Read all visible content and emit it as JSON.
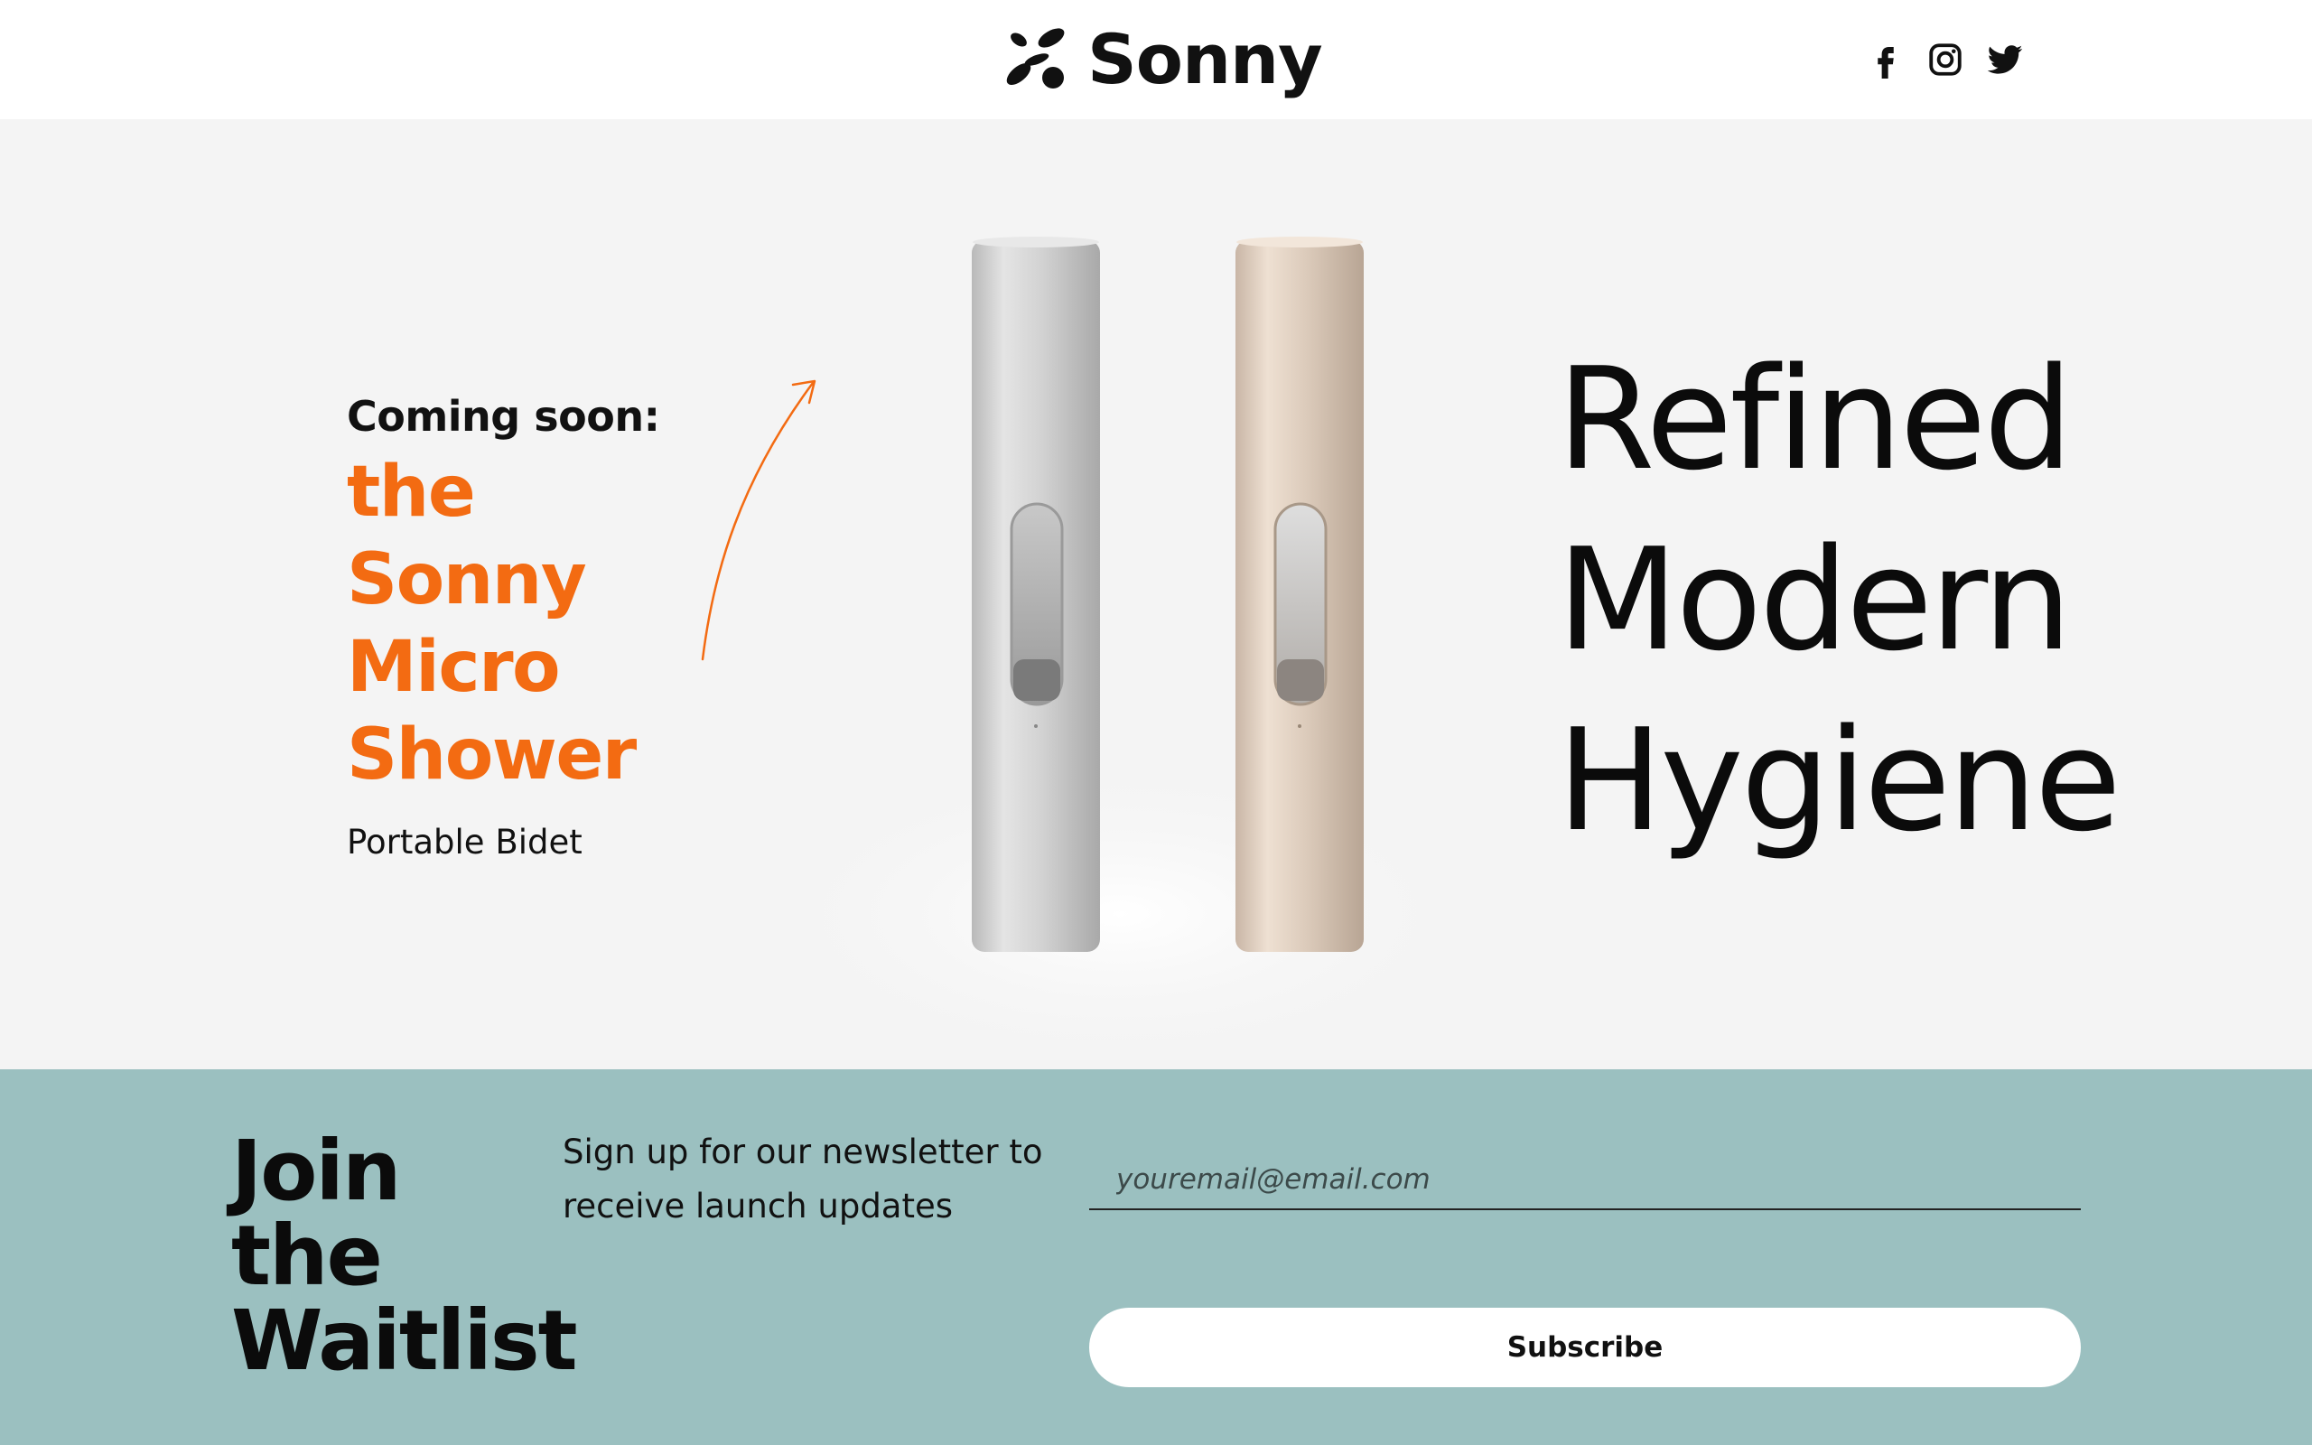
{
  "header": {
    "brand_name": "Sonny",
    "logo_icon": "sonny-flower-logo-icon",
    "social": [
      {
        "name": "facebook",
        "icon": "facebook-icon"
      },
      {
        "name": "instagram",
        "icon": "instagram-icon"
      },
      {
        "name": "twitter",
        "icon": "twitter-icon"
      }
    ]
  },
  "hero": {
    "coming_soon": "Coming soon:",
    "product_title": "the Sonny Micro Shower",
    "product_subtitle": "Portable Bidet",
    "tagline": [
      "Refined",
      "Modern",
      "Hygiene"
    ],
    "product_colors": [
      "silver",
      "rose gold"
    ]
  },
  "waitlist": {
    "title": "Join the Waitlist",
    "description": "Sign up for our newsletter to receive launch updates",
    "email_placeholder": "youremail@email.com",
    "email_value": "",
    "subscribe_label": "Subscribe"
  },
  "colors": {
    "accent_orange": "#f36b12",
    "waitlist_bg": "#9bc0c0",
    "hero_bg": "#f4f4f4",
    "text": "#111111"
  }
}
